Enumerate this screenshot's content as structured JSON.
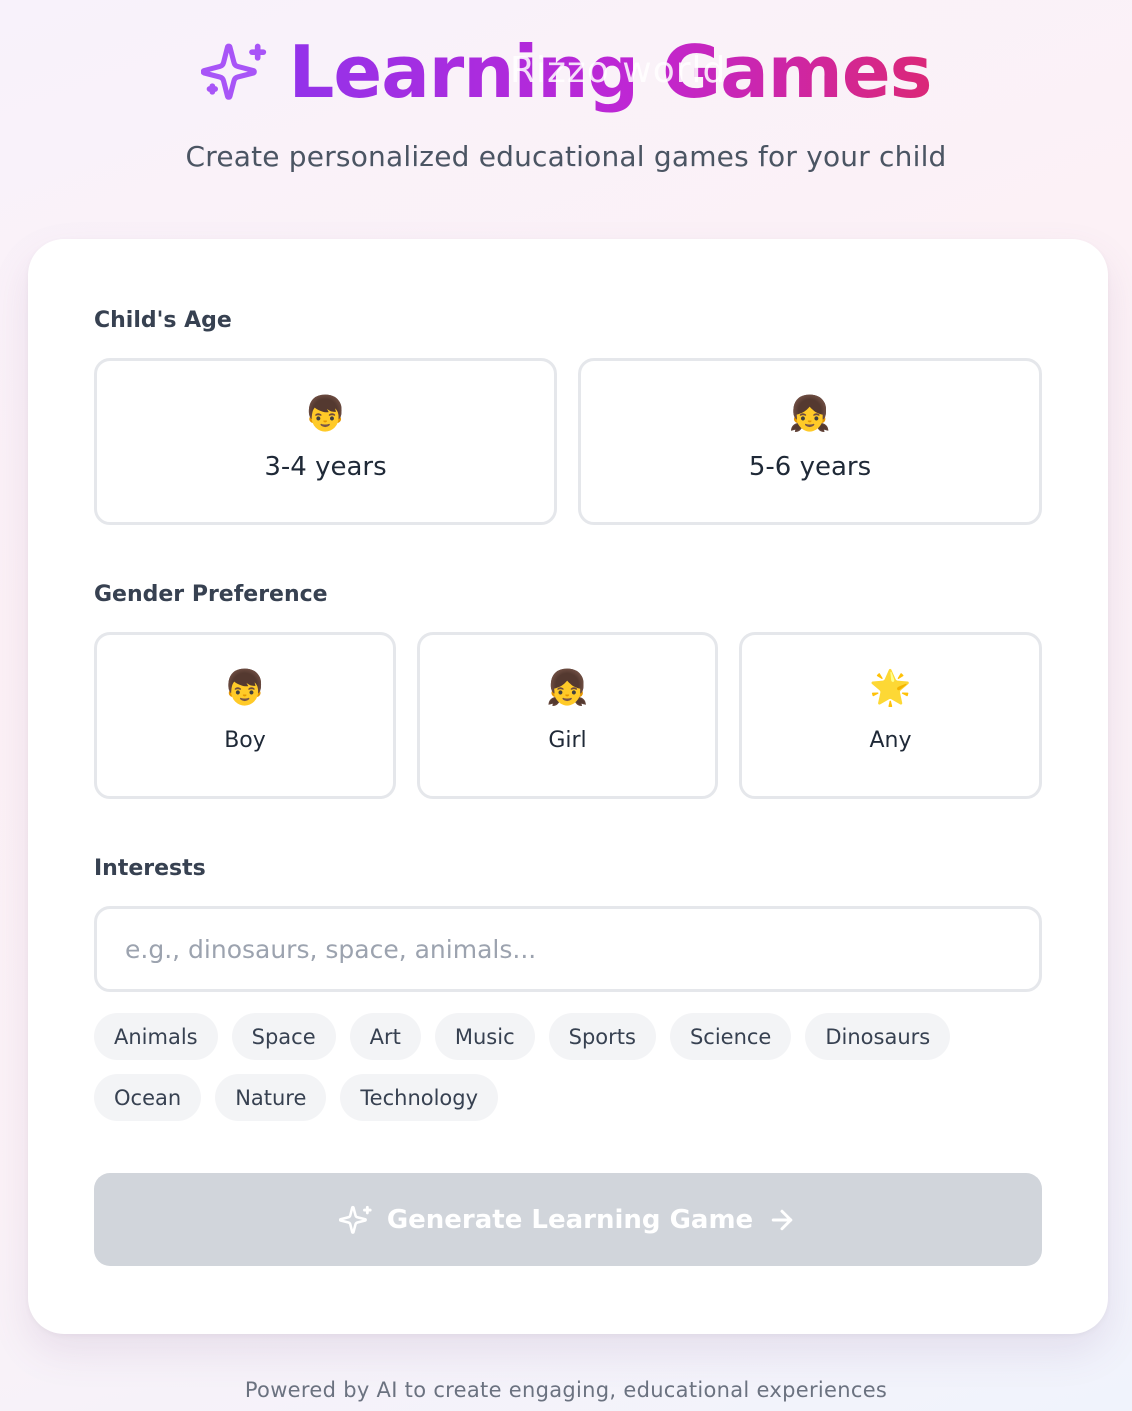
{
  "header": {
    "title": "Learning Games",
    "watermark": "Rizzo world",
    "subtitle": "Create personalized educational games for your child"
  },
  "age": {
    "label": "Child's Age",
    "options": [
      {
        "emoji": "👦",
        "label": "3-4 years"
      },
      {
        "emoji": "👧",
        "label": "5-6 years"
      }
    ]
  },
  "gender": {
    "label": "Gender Preference",
    "options": [
      {
        "emoji": "👦",
        "label": "Boy"
      },
      {
        "emoji": "👧",
        "label": "Girl"
      },
      {
        "emoji": "🌟",
        "label": "Any"
      }
    ]
  },
  "interests": {
    "label": "Interests",
    "value": "",
    "placeholder": "e.g., dinosaurs, space, animals...",
    "chips": [
      "Animals",
      "Space",
      "Art",
      "Music",
      "Sports",
      "Science",
      "Dinosaurs",
      "Ocean",
      "Nature",
      "Technology"
    ]
  },
  "generate": {
    "label": "Generate Learning Game"
  },
  "footer": {
    "text": "Powered by AI to create engaging, educational experiences"
  },
  "colors": {
    "title_gradient_start": "#9333ea",
    "title_gradient_end": "#db2777",
    "button_disabled": "#d1d5db",
    "chip_bg": "#f3f4f6"
  }
}
